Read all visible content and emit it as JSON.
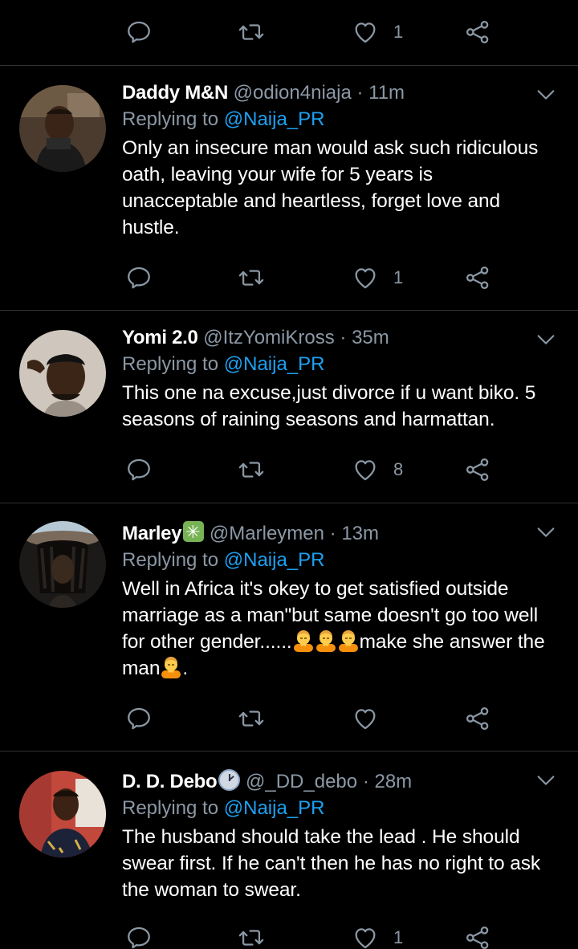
{
  "colors": {
    "background": "#000000",
    "text": "#ffffff",
    "muted": "#8b98a5",
    "link": "#1da1f2",
    "divider": "#2f3336"
  },
  "top_partial": {
    "like_count": "1"
  },
  "tweets": [
    {
      "name": "Daddy M&N",
      "handle": "@odion4niaja",
      "separator": "·",
      "time": "11m",
      "replying_prefix": "Replying to",
      "replying_to": "@Naija_PR",
      "text": "Only an insecure man would ask such ridiculous oath, leaving your wife for 5 years is unacceptable and heartless, forget love and hustle.",
      "like_count": "1"
    },
    {
      "name": "Yomi 2.0",
      "handle": "@ItzYomiKross",
      "separator": "·",
      "time": "35m",
      "replying_prefix": "Replying to",
      "replying_to": "@Naija_PR",
      "text": "This one na excuse,just divorce if u want biko. 5 seasons of raining seasons and harmattan.",
      "like_count": "8"
    },
    {
      "name": "Marley",
      "name_emoji": "eight-spoked-asterisk-emoji",
      "handle": "@Marleymen",
      "separator": "·",
      "time": "13m",
      "replying_prefix": "Replying to",
      "replying_to": "@Naija_PR",
      "text_part1": "Well in Africa it's okey to get satisfied outside marriage as a man\"but same doesn't go too well for other gender......",
      "text_part2": "make she answer the man",
      "text_part3": ".",
      "like_count": ""
    },
    {
      "name": "D. D. Debo",
      "name_emoji": "clock-emoji",
      "handle": "@_DD_debo",
      "separator": "·",
      "time": "28m",
      "replying_prefix": "Replying to",
      "replying_to": "@Naija_PR",
      "text": "The husband should take the lead . He should swear first. If he can't then he has no right to ask the woman to swear.",
      "like_count": "1"
    }
  ],
  "icons": {
    "reply": "reply-icon",
    "retweet": "retweet-icon",
    "like": "heart-icon",
    "share": "share-icon",
    "more": "chevron-down-icon"
  }
}
